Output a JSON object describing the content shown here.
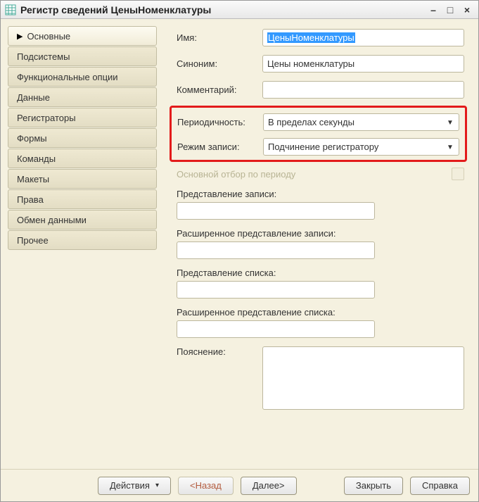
{
  "title": "Регистр сведений ЦеныНоменклатуры",
  "sidebar": {
    "items": [
      {
        "label": "Основные"
      },
      {
        "label": "Подсистемы"
      },
      {
        "label": "Функциональные опции"
      },
      {
        "label": "Данные"
      },
      {
        "label": "Регистраторы"
      },
      {
        "label": "Формы"
      },
      {
        "label": "Команды"
      },
      {
        "label": "Макеты"
      },
      {
        "label": "Права"
      },
      {
        "label": "Обмен данными"
      },
      {
        "label": "Прочее"
      }
    ]
  },
  "form": {
    "name_label": "Имя:",
    "name_value": "ЦеныНоменклатуры",
    "synonym_label": "Синоним:",
    "synonym_value": "Цены номенклатуры",
    "comment_label": "Комментарий:",
    "comment_value": "",
    "periodicity_label": "Периодичность:",
    "periodicity_value": "В пределах секунды",
    "write_mode_label": "Режим записи:",
    "write_mode_value": "Подчинение регистратору",
    "main_filter_label": "Основной отбор по периоду",
    "record_repr_label": "Представление записи:",
    "record_repr_value": "",
    "record_repr_ext_label": "Расширенное представление записи:",
    "record_repr_ext_value": "",
    "list_repr_label": "Представление списка:",
    "list_repr_value": "",
    "list_repr_ext_label": "Расширенное представление списка:",
    "list_repr_ext_value": "",
    "explanation_label": "Пояснение:",
    "explanation_value": ""
  },
  "footer": {
    "actions": "Действия",
    "back": "<Назад",
    "next": "Далее>",
    "close": "Закрыть",
    "help": "Справка"
  }
}
